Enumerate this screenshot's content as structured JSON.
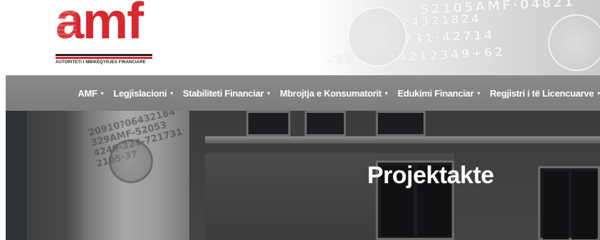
{
  "header": {
    "logo": {
      "wordmark": "amf",
      "subtitle": "AUTORITETI I MBIKËQYRJES FINANCIARE",
      "icon": "amf-logo-icon"
    },
    "watermark_icon": "numbers-watermark-icon"
  },
  "nav": {
    "items": [
      {
        "label": "AMF",
        "icon": "chevron-down-icon"
      },
      {
        "label": "Legjislacioni",
        "icon": "chevron-down-icon"
      },
      {
        "label": "Stabiliteti Financiar",
        "icon": "chevron-down-icon"
      },
      {
        "label": "Mbrojtja e Konsumatorit",
        "icon": "chevron-down-icon"
      },
      {
        "label": "Edukimi Financiar",
        "icon": "chevron-down-icon"
      },
      {
        "label": "Regjistri i të Licencuarve",
        "icon": "chevron-down-icon"
      }
    ],
    "caret": "▾"
  },
  "hero": {
    "title": "Projektakte"
  },
  "colors": {
    "brand_red": "#d8282f",
    "nav_bg": "#858585",
    "text_white": "#ffffff"
  }
}
